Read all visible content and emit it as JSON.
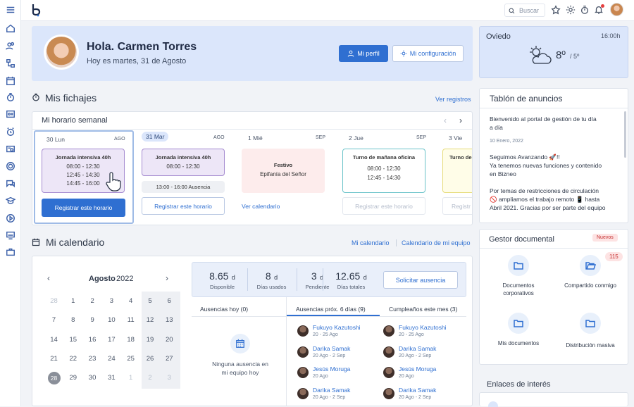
{
  "topbar": {
    "search_placeholder": "Buscar"
  },
  "header": {
    "greeting": "Hola. Carmen Torres",
    "date": "Hoy es martes, 31 de Agosto",
    "my_profile": "Mi perfil",
    "my_config": "Mi configuración"
  },
  "weather": {
    "city": "Oviedo",
    "time": "16:00h",
    "temp_high": "8º",
    "temp_low": "/ 5º"
  },
  "fichajes": {
    "title": "Mis fichajes",
    "see_records": "Ver registros",
    "weekly_title": "Mi horario semanal",
    "days": [
      {
        "day": "30 Lun",
        "month": "AGO",
        "shift_title": "Jornada intensiva 40h",
        "times": [
          "08:00 - 12:30",
          "12:45 - 14:30",
          "14:45 - 16:00"
        ],
        "action": "Registrar este horario"
      },
      {
        "day": "31 Mar",
        "month": "AGO",
        "shift_title": "Jornada intensiva 40h",
        "times": [
          "08:00 - 12:30"
        ],
        "absence": "13:00 - 16:00  Ausencia",
        "action": "Registrar este horario"
      },
      {
        "day": "1 Mié",
        "month": "SEP",
        "shift_title": "Festivo",
        "times": [
          "Epifanía del Señor"
        ],
        "action": "Ver calendario"
      },
      {
        "day": "2 Jue",
        "month": "SEP",
        "shift_title": "Turno de mañana oficina",
        "times": [
          "08:00 - 12:30",
          "12:45 - 14:30"
        ],
        "action": "Registrar este horario"
      },
      {
        "day": "3 Vie",
        "month": "",
        "shift_title": "Turno de",
        "times": [],
        "action": "Registr"
      }
    ]
  },
  "calendar": {
    "title": "Mi calendario",
    "my_calendar": "Mi calendario",
    "team_calendar": "Calendario de mi equipo",
    "month": "Agosto",
    "year": "2022",
    "weeks": [
      [
        "28",
        "1",
        "2",
        "3",
        "4",
        "5",
        "6"
      ],
      [
        "7",
        "8",
        "9",
        "10",
        "11",
        "12",
        "13"
      ],
      [
        "14",
        "15",
        "16",
        "17",
        "18",
        "19",
        "20"
      ],
      [
        "21",
        "22",
        "23",
        "24",
        "25",
        "26",
        "27"
      ],
      [
        "28",
        "29",
        "30",
        "31",
        "1",
        "2",
        "3"
      ]
    ]
  },
  "stats": [
    {
      "value": "8.65",
      "unit": "d",
      "label": "Disponible"
    },
    {
      "value": "8",
      "unit": "d",
      "label": "Días usados"
    },
    {
      "value": "3",
      "unit": "d",
      "label": "Pendiente"
    },
    {
      "value": "12.65",
      "unit": "d",
      "label": "Días totales"
    }
  ],
  "request_absence": "Solicitar ausencia",
  "absence_tabs": [
    "Ausencias hoy (0)",
    "Ausencias próx. 6 días (9)",
    "Cumpleaños este mes (3)"
  ],
  "no_absence": [
    "Ninguna ausencia en",
    "mi equipo hoy"
  ],
  "upcoming": [
    {
      "name": "Fukuyo Kazutoshi",
      "date": "20 - 25 Ago"
    },
    {
      "name": "Fukuyo Kazutoshi",
      "date": "20 - 25 Ago"
    },
    {
      "name": "Darika Samak",
      "date": "20 Ago - 2 Sep"
    },
    {
      "name": "Darika Samak",
      "date": "20 Ago - 2 Sep"
    },
    {
      "name": "Jesús Moruga",
      "date": "20 Ago"
    },
    {
      "name": "Jesús Moruga",
      "date": "20 Ago"
    },
    {
      "name": "Darika Samak",
      "date": "20 Ago - 2 Sep"
    },
    {
      "name": "Darika Samak",
      "date": "20 Ago - 2 Sep"
    }
  ],
  "board": {
    "title": "Tablón de anuncios",
    "posts": [
      {
        "text": [
          "Bienvenido al portal de gestión de tu día",
          "a día"
        ],
        "date": "10 Enero, 2022"
      },
      {
        "text": [
          "Seguimos Avanzando 🚀!!",
          "Ya tenemos nuevas funciones y contenido",
          "en Bizneo"
        ]
      },
      {
        "text": [
          "Por temas de restricciones de circulación",
          "🚫 ampliamos el trabajo remoto 📱 hasta",
          "Abril 2021. Gracias por ser parte del equipo"
        ]
      }
    ]
  },
  "docs": {
    "title": "Gestor documental",
    "new_badge": "Nuevos",
    "count_badge": "115",
    "items": [
      "Documentos corporativos",
      "Compartido conmigo",
      "Mis documentos",
      "Distribución masiva"
    ]
  },
  "links": {
    "title": "Enlaces de interés"
  }
}
